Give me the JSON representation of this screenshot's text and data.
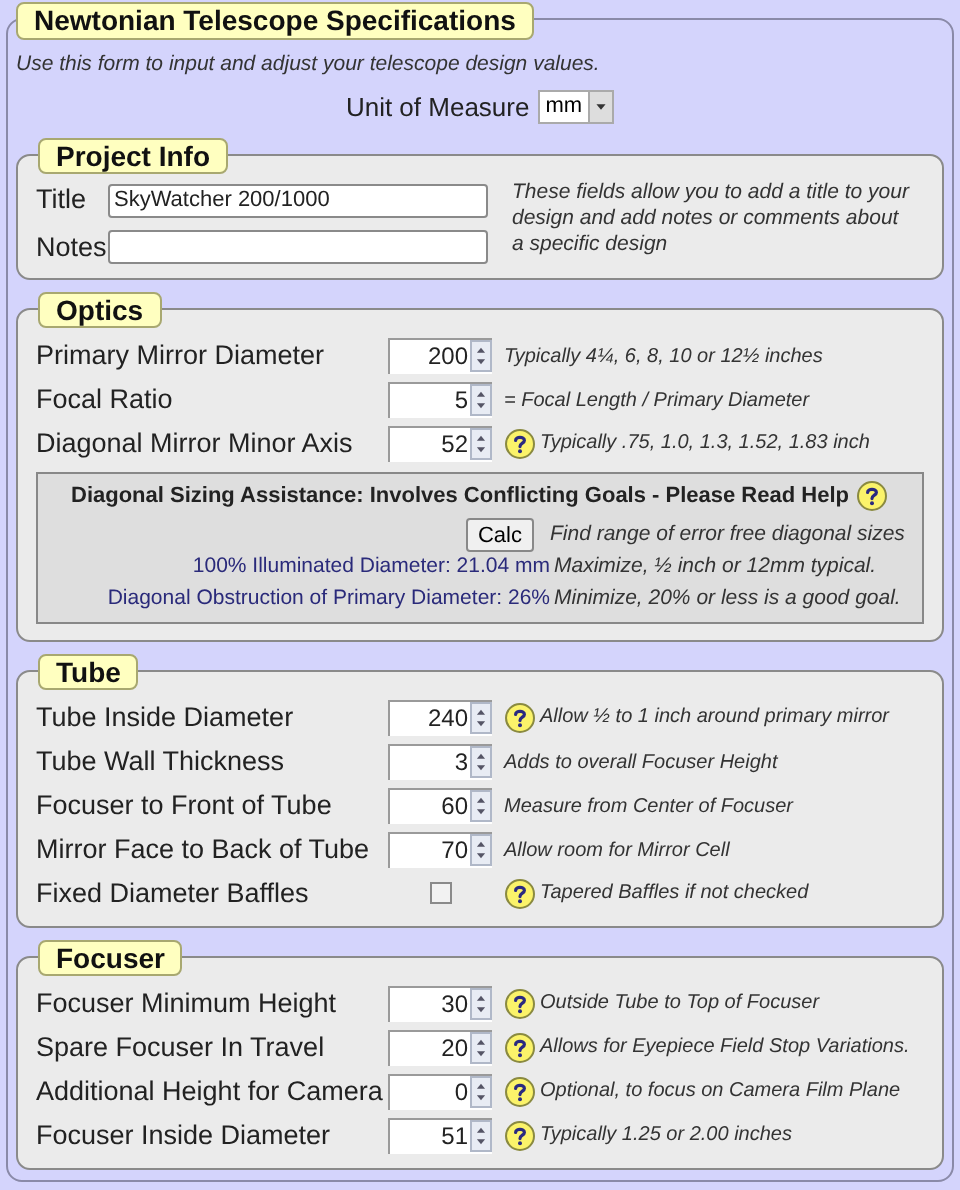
{
  "title": "Newtonian Telescope Specifications",
  "intro": "Use this form to input and adjust your telescope design values.",
  "unit": {
    "label": "Unit of Measure",
    "value": "mm"
  },
  "sections": [
    {
      "title": "Project Info",
      "fields": [
        {
          "label": "Title",
          "value": "SkyWatcher 200/1000"
        },
        {
          "label": "Notes"
        }
      ],
      "note": "These fields allow you to add a title to your design and add notes or comments about a specific design"
    },
    {
      "title": "Optics",
      "rows": [
        {
          "kind": "spin",
          "label": "Primary Mirror Diameter",
          "value": "200",
          "help": false,
          "hint": "Typically 4¼, 6, 8, 10 or 12½ inches"
        },
        {
          "kind": "spin",
          "label": "Focal Ratio",
          "value": "5",
          "help": false,
          "hint": "= Focal Length / Primary Diameter"
        },
        {
          "kind": "spin",
          "label": "Diagonal Mirror Minor Axis",
          "value": "52",
          "help": true,
          "hint": "Typically .75, 1.0, 1.3, 1.52, 1.83 inch"
        }
      ],
      "assist": {
        "title": "Diagonal Sizing Assistance: Involves Conflicting Goals - Please Read Help",
        "button": "Calc",
        "button_hint": "Find range of error free diagonal sizes",
        "results": [
          {
            "label": "100% Illuminated Diameter: 21.04 mm",
            "hint": "Maximize, ½ inch or 12mm typical."
          },
          {
            "label": "Diagonal Obstruction of Primary Diameter: 26%",
            "hint": "Minimize, 20% or less is a good goal."
          }
        ]
      }
    },
    {
      "title": "Tube",
      "rows": [
        {
          "kind": "spin",
          "label": "Tube Inside Diameter",
          "value": "240",
          "help": true,
          "hint": "Allow ½ to 1 inch around primary mirror"
        },
        {
          "kind": "spin",
          "label": "Tube Wall Thickness",
          "value": "3",
          "help": false,
          "hint": "Adds to overall Focuser Height"
        },
        {
          "kind": "spin",
          "label": "Focuser to Front of Tube",
          "value": "60",
          "help": false,
          "hint": "Measure from Center of Focuser"
        },
        {
          "kind": "spin",
          "label": "Mirror Face to Back of Tube",
          "value": "70",
          "help": false,
          "hint": "Allow room for Mirror Cell"
        },
        {
          "kind": "checkbox",
          "label": "Fixed Diameter Baffles",
          "checked": false,
          "help": true,
          "hint": "Tapered Baffles if not checked"
        }
      ]
    },
    {
      "title": "Focuser",
      "rows": [
        {
          "kind": "spin",
          "label": "Focuser Minimum Height",
          "value": "30",
          "help": true,
          "hint": "Outside Tube to Top of Focuser"
        },
        {
          "kind": "spin",
          "label": "Spare Focuser In Travel",
          "value": "20",
          "help": true,
          "hint": "Allows for Eyepiece Field Stop Variations."
        },
        {
          "kind": "spin",
          "label": "Additional Height for Camera",
          "value": "0",
          "help": true,
          "hint": "Optional, to focus on Camera Film Plane"
        },
        {
          "kind": "spin",
          "label": "Focuser Inside Diameter",
          "value": "51",
          "help": true,
          "hint": "Typically 1.25 or 2.00 inches"
        }
      ]
    }
  ]
}
